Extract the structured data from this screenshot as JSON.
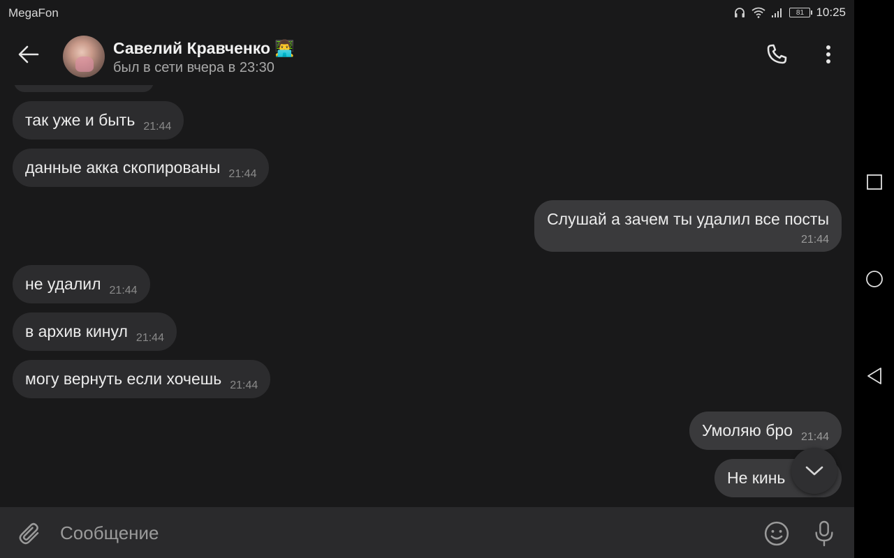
{
  "status_bar": {
    "carrier": "MegaFon",
    "battery": "81",
    "time": "10:25"
  },
  "header": {
    "contact_name": "Савелий Кравченко 👨‍💻",
    "contact_status": "был в сети вчера в 23:30"
  },
  "messages": [
    {
      "direction": "in",
      "text": "так уже и быть",
      "time": "21:44"
    },
    {
      "direction": "in",
      "text": "данные акка скопированы",
      "time": "21:44"
    },
    {
      "direction": "out",
      "text": "Слушай а зачем ты удалил все посты",
      "time": "21:44"
    },
    {
      "direction": "in",
      "text": "не удалил",
      "time": "21:44"
    },
    {
      "direction": "in",
      "text": "в архив кинул",
      "time": "21:44"
    },
    {
      "direction": "in",
      "text": "могу вернуть если хочешь",
      "time": "21:44"
    },
    {
      "direction": "out",
      "text": "Умоляю бро",
      "time": "21:44"
    },
    {
      "direction": "out",
      "text": "Не кинь",
      "time": ""
    }
  ],
  "composer": {
    "placeholder": "Сообщение",
    "value": ""
  },
  "colors": {
    "background": "#19191a",
    "incoming_bubble": "#2c2c2e",
    "outgoing_bubble": "#3a3a3c",
    "input_bar": "#2a2a2c"
  },
  "icons": {
    "back": "arrow-left-icon",
    "call": "phone-icon",
    "more": "more-vertical-icon",
    "attach": "paperclip-icon",
    "emoji": "smile-icon",
    "mic": "microphone-icon",
    "scroll": "chevron-down-icon"
  }
}
